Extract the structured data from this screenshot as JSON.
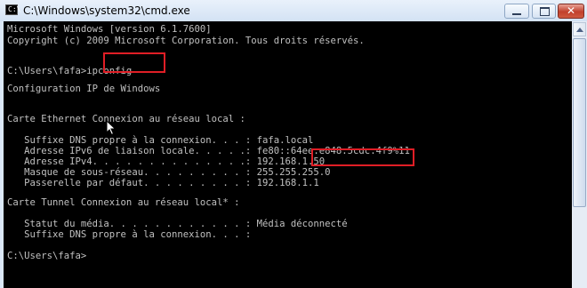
{
  "window": {
    "title": "C:\\Windows\\system32\\cmd.exe",
    "icon_text": "C:\\"
  },
  "controls": {
    "minimize": "minimize",
    "maximize": "maximize",
    "close": "✕"
  },
  "console": {
    "lines": [
      "Microsoft Windows [version 6.1.7600]",
      "Copyright (c) 2009 Microsoft Corporation. Tous droits réservés.",
      "",
      "C:\\Users\\fafa>ipconfig",
      "",
      "Configuration IP de Windows",
      "",
      "",
      "Carte Ethernet Connexion au réseau local :",
      "",
      "   Suffixe DNS propre à la connexion. . . : fafa.local",
      "   Adresse IPv6 de liaison locale. . . . .: fe80::64ee:e848:5cdc:4f9%11",
      "   Adresse IPv4. . . . . . . . . . . . . .: 192.168.1.50",
      "   Masque de sous-réseau. . . . . . . . . : 255.255.255.0",
      "   Passerelle par défaut. . . . . . . . . : 192.168.1.1",
      "",
      "Carte Tunnel Connexion au réseau local* :",
      "",
      "   Statut du média. . . . . . . . . . . . : Média déconnecté",
      "   Suffixe DNS propre à la connexion. . . :",
      "",
      "C:\\Users\\fafa>"
    ]
  },
  "highlight_color": "#e01e26",
  "console_text_color": "#c0c0c0"
}
